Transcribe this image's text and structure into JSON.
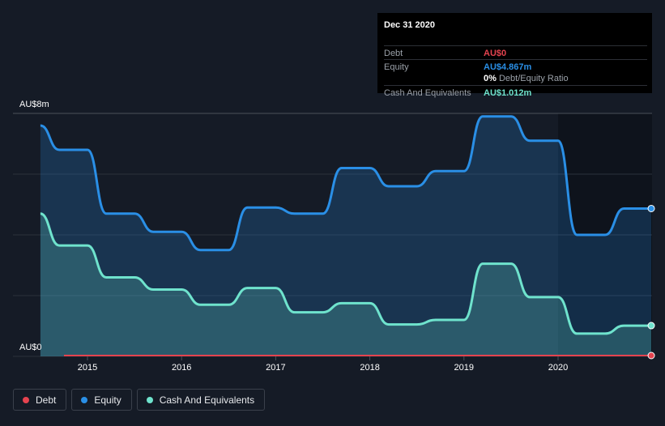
{
  "chart_data": {
    "type": "area",
    "title": "",
    "xlabel": "",
    "ylabel": "",
    "y_unit": "AU$m",
    "ylim": [
      0,
      8
    ],
    "y_tick_labels": [
      "AU$0",
      "AU$8m"
    ],
    "x_tick_labels": [
      "2015",
      "2016",
      "2017",
      "2018",
      "2019",
      "2020"
    ],
    "xlim": [
      2014.5,
      2021.0
    ],
    "grid": true,
    "legend_position": "bottom-left",
    "series": [
      {
        "name": "Debt",
        "color": "#e5434f",
        "x": [
          2014.75,
          2020.99
        ],
        "y": [
          0,
          0
        ]
      },
      {
        "name": "Equity",
        "color": "#2a8fe6",
        "x": [
          2014.5,
          2014.7,
          2015.0,
          2015.2,
          2015.5,
          2015.7,
          2016.0,
          2016.2,
          2016.5,
          2016.7,
          2017.0,
          2017.2,
          2017.5,
          2017.7,
          2018.0,
          2018.2,
          2018.5,
          2018.7,
          2019.0,
          2019.2,
          2019.5,
          2019.7,
          2020.0,
          2020.2,
          2020.5,
          2020.7,
          2020.99
        ],
        "y": [
          7.6,
          6.8,
          6.8,
          4.7,
          4.7,
          4.1,
          4.1,
          3.5,
          3.5,
          4.9,
          4.9,
          4.7,
          4.7,
          6.2,
          6.2,
          5.6,
          5.6,
          6.1,
          6.1,
          7.9,
          7.9,
          7.1,
          7.1,
          4.0,
          4.0,
          4.867,
          4.867
        ]
      },
      {
        "name": "Cash And Equivalents",
        "color": "#6fe3cd",
        "x": [
          2014.5,
          2014.7,
          2015.0,
          2015.2,
          2015.5,
          2015.7,
          2016.0,
          2016.2,
          2016.5,
          2016.7,
          2017.0,
          2017.2,
          2017.5,
          2017.7,
          2018.0,
          2018.2,
          2018.5,
          2018.7,
          2019.0,
          2019.2,
          2019.5,
          2019.7,
          2020.0,
          2020.2,
          2020.5,
          2020.7,
          2020.99
        ],
        "y": [
          4.7,
          3.65,
          3.65,
          2.6,
          2.6,
          2.2,
          2.2,
          1.7,
          1.7,
          2.25,
          2.25,
          1.45,
          1.45,
          1.75,
          1.75,
          1.05,
          1.05,
          1.2,
          1.2,
          3.05,
          3.05,
          1.95,
          1.95,
          0.75,
          0.75,
          1.012,
          1.012
        ]
      }
    ]
  },
  "tooltip": {
    "date": "Dec 31 2020",
    "rows": [
      {
        "label": "Debt",
        "value": "AU$0",
        "color": "#e5434f"
      },
      {
        "label": "Equity",
        "value": "AU$4.867m",
        "color": "#2a8fe6"
      },
      {
        "label": "",
        "value": "0%",
        "color": "#ffffff",
        "suffix": "Debt/Equity Ratio"
      },
      {
        "label": "Cash And Equivalents",
        "value": "AU$1.012m",
        "color": "#6fe3cd"
      }
    ]
  },
  "legend": [
    {
      "label": "Debt",
      "color": "#e5434f"
    },
    {
      "label": "Equity",
      "color": "#2a8fe6"
    },
    {
      "label": "Cash And Equivalents",
      "color": "#6fe3cd"
    }
  ]
}
